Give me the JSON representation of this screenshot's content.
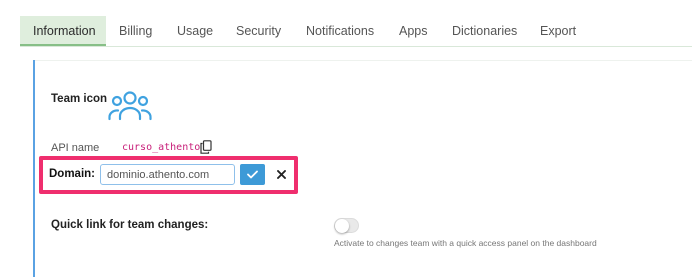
{
  "tabs": [
    {
      "label": "Information",
      "active": true
    },
    {
      "label": "Billing",
      "active": false
    },
    {
      "label": "Usage",
      "active": false
    },
    {
      "label": "Security",
      "active": false
    },
    {
      "label": "Notifications",
      "active": false
    },
    {
      "label": "Apps",
      "active": false
    },
    {
      "label": "Dictionaries",
      "active": false
    },
    {
      "label": "Export",
      "active": false
    }
  ],
  "team": {
    "icon_label": "Team icon",
    "icon": "team-users-icon",
    "icon_color": "#3fa2e0"
  },
  "api": {
    "label": "API name",
    "value": "curso_athento",
    "copy_icon": "copy-icon"
  },
  "domain": {
    "label": "Domain:",
    "value": "dominio.athento.com",
    "confirm_icon": "check-icon",
    "cancel_icon": "close-icon",
    "highlight_color": "#ef2e6e",
    "confirm_color": "#3d9ad7"
  },
  "quick_link": {
    "label": "Quick link for team changes:",
    "enabled": false,
    "help": "Activate to changes team with a quick access panel on the dashboard"
  }
}
